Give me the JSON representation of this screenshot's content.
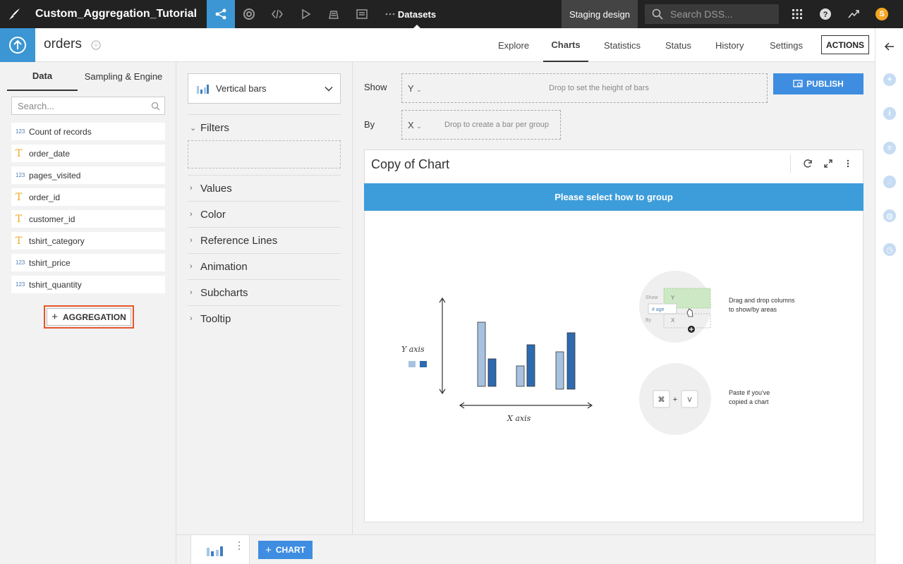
{
  "topbar": {
    "project_name": "Custom_Aggregation_Tutorial",
    "section": "Datasets",
    "instance": "Staging design",
    "search_placeholder": "Search DSS...",
    "avatar_initial": "S",
    "nav_icons": [
      "flow-icon",
      "jobs-icon",
      "code-icon",
      "run-icon",
      "deploy-icon",
      "dashboard-icon",
      "more-icon"
    ]
  },
  "dataset": {
    "name": "orders",
    "tabs": [
      "Explore",
      "Charts",
      "Statistics",
      "Status",
      "History",
      "Settings"
    ],
    "active_tab": "Charts",
    "actions_label": "ACTIONS"
  },
  "left_panel": {
    "tabs": [
      "Data",
      "Sampling & Engine"
    ],
    "active_tab": "Data",
    "search_placeholder": "Search...",
    "columns": [
      {
        "name": "Count of records",
        "type": "123"
      },
      {
        "name": "order_date",
        "type": "T"
      },
      {
        "name": "pages_visited",
        "type": "123"
      },
      {
        "name": "order_id",
        "type": "T"
      },
      {
        "name": "customer_id",
        "type": "T"
      },
      {
        "name": "tshirt_category",
        "type": "T"
      },
      {
        "name": "tshirt_price",
        "type": "123"
      },
      {
        "name": "tshirt_quantity",
        "type": "123"
      }
    ],
    "aggregation_label": "AGGREGATION"
  },
  "middle_panel": {
    "chart_type": "Vertical bars",
    "sections": [
      "Filters",
      "Values",
      "Color",
      "Reference Lines",
      "Animation",
      "Subcharts",
      "Tooltip"
    ]
  },
  "main": {
    "show_label": "Show",
    "by_label": "By",
    "y_axis": "Y",
    "x_axis": "X",
    "y_placeholder": "Drop to set the height of bars",
    "x_placeholder": "Drop to create a bar per group",
    "publish_label": "PUBLISH",
    "chart_title": "Copy of Chart",
    "banner": "Please select how to group",
    "illustration": {
      "y_axis_label": "Y axis",
      "x_axis_label": "X axis",
      "hint_show": "Show",
      "hint_by": "By",
      "hint_y": "Y",
      "hint_x": "X",
      "hint_column": "# age",
      "hint_cmd": "⌘",
      "hint_plus": "+",
      "hint_v": "V"
    },
    "hint_drag_line1": "Drag and drop columns",
    "hint_drag_line2": "to show/by areas",
    "hint_paste_line1": "Paste if you've",
    "hint_paste_line2": "copied a chart"
  },
  "bottom": {
    "add_chart_label": "CHART"
  },
  "colors": {
    "accent": "#3b96d3",
    "button_blue": "#3f8de0",
    "highlight": "#e8552a",
    "topbar": "#222222"
  }
}
